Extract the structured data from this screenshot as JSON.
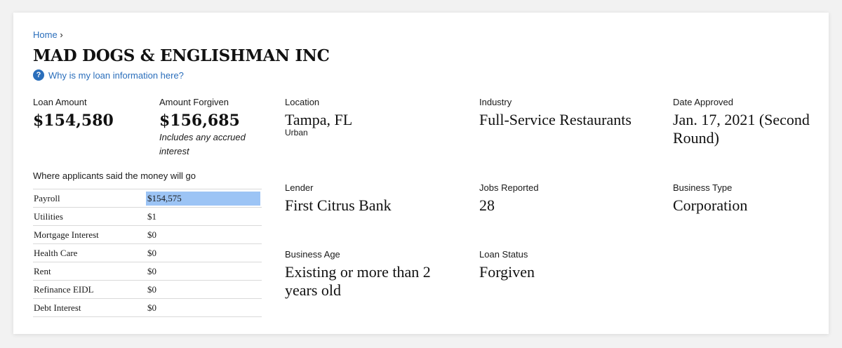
{
  "breadcrumb": {
    "home": "Home",
    "sep": "›"
  },
  "title": "MAD DOGS & ENGLISHMAN INC",
  "why_link": "Why is my loan information here?",
  "loan_amount": {
    "label": "Loan Amount",
    "value": "$154,580"
  },
  "amount_forgiven": {
    "label": "Amount Forgiven",
    "value": "$156,685",
    "note": "Includes any accrued interest"
  },
  "money_heading": "Where applicants said the money will go",
  "money_rows": [
    {
      "category": "Payroll",
      "amount": "$154,575"
    },
    {
      "category": "Utilities",
      "amount": "$1"
    },
    {
      "category": "Mortgage Interest",
      "amount": "$0"
    },
    {
      "category": "Health Care",
      "amount": "$0"
    },
    {
      "category": "Rent",
      "amount": "$0"
    },
    {
      "category": "Refinance EIDL",
      "amount": "$0"
    },
    {
      "category": "Debt Interest",
      "amount": "$0"
    }
  ],
  "details": {
    "location": {
      "label": "Location",
      "value": "Tampa, FL",
      "sub": "Urban"
    },
    "industry": {
      "label": "Industry",
      "value": "Full-Service Restaurants"
    },
    "date_approved": {
      "label": "Date Approved",
      "value": "Jan. 17, 2021 (Second Round)"
    },
    "lender": {
      "label": "Lender",
      "value": "First Citrus Bank"
    },
    "jobs": {
      "label": "Jobs Reported",
      "value": "28"
    },
    "business_type": {
      "label": "Business Type",
      "value": "Corporation"
    },
    "business_age": {
      "label": "Business Age",
      "value": "Existing or more than 2 years old"
    },
    "loan_status": {
      "label": "Loan Status",
      "value": "Forgiven"
    }
  },
  "colors": {
    "link": "#2a6ebb",
    "highlight": "#9cc4f5"
  }
}
